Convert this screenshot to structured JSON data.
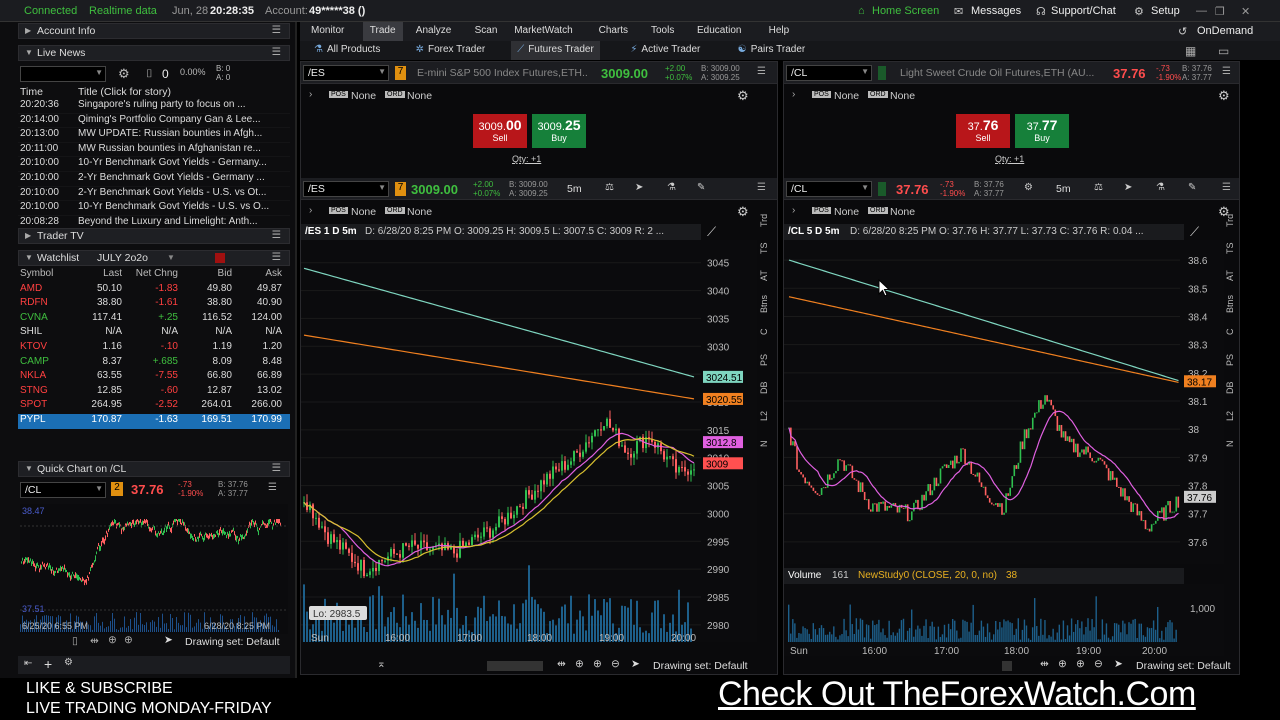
{
  "topbar": {
    "connection": "Connected",
    "feed": "Realtime data",
    "date": "Jun, 28",
    "time": "20:28:35",
    "account_label": "Account:",
    "account": "49*****38 ()",
    "home": "Home Screen",
    "messages": "Messages",
    "support": "Support/Chat",
    "setup": "Setup"
  },
  "nav": {
    "tabs": [
      "Monitor",
      "Trade",
      "Analyze",
      "Scan",
      "MarketWatch",
      "Charts",
      "Tools",
      "Education",
      "Help"
    ],
    "active": "Trade",
    "ondemand": "OnDemand",
    "subtabs": [
      "All Products",
      "Forex Trader",
      "Futures Trader",
      "Active Trader",
      "Pairs Trader"
    ],
    "active_sub": "Futures Trader"
  },
  "left": {
    "account_info": "Account Info",
    "live_news": "Live News",
    "news_toolbar": {
      "zero": "0",
      "pct": "0.00%",
      "b": "B: 0",
      "a": "A: 0"
    },
    "news_headers": {
      "time": "Time",
      "title": "Title (Click for story)"
    },
    "news": [
      {
        "t": "20:20:36",
        "s": "Singapore's ruling party to focus on ..."
      },
      {
        "t": "20:14:00",
        "s": "Qiming's Portfolio Company Gan & Lee..."
      },
      {
        "t": "20:13:00",
        "s": "MW UPDATE: Russian bounties in Afgh..."
      },
      {
        "t": "20:11:00",
        "s": "MW Russian bounties in Afghanistan re..."
      },
      {
        "t": "20:10:00",
        "s": "10-Yr Benchmark Govt Yields - Germany..."
      },
      {
        "t": "20:10:00",
        "s": "2-Yr Benchmark Govt Yields - Germany ..."
      },
      {
        "t": "20:10:00",
        "s": "2-Yr Benchmark Govt Yields - U.S. vs Ot..."
      },
      {
        "t": "20:10:00",
        "s": "10-Yr Benchmark Govt Yields - U.S. vs O..."
      },
      {
        "t": "20:08:28",
        "s": "Beyond the Luxury and Limelight: Anth..."
      }
    ],
    "trader_tv": "Trader TV",
    "watchlist": "Watchlist",
    "watchlist_name": "JULY 2o2o",
    "wl_headers": [
      "Symbol",
      "Last",
      "Net Chng",
      "Bid",
      "Ask"
    ],
    "wl_rows": [
      {
        "sym": "AMD",
        "last": "50.10",
        "chg": "-1.83",
        "bid": "49.80",
        "ask": "49.87",
        "dir": "down"
      },
      {
        "sym": "RDFN",
        "last": "38.80",
        "chg": "-1.61",
        "bid": "38.80",
        "ask": "40.90",
        "dir": "down"
      },
      {
        "sym": "CVNA",
        "last": "117.41",
        "chg": "+.25",
        "bid": "116.52",
        "ask": "124.00",
        "dir": "up"
      },
      {
        "sym": "SHIL",
        "last": "N/A",
        "chg": "N/A",
        "bid": "N/A",
        "ask": "N/A",
        "dir": "none"
      },
      {
        "sym": "KTOV",
        "last": "1.16",
        "chg": "-.10",
        "bid": "1.19",
        "ask": "1.20",
        "dir": "down"
      },
      {
        "sym": "CAMP",
        "last": "8.37",
        "chg": "+.685",
        "bid": "8.09",
        "ask": "8.48",
        "dir": "up"
      },
      {
        "sym": "NKLA",
        "last": "63.55",
        "chg": "-7.55",
        "bid": "66.80",
        "ask": "66.89",
        "dir": "down"
      },
      {
        "sym": "STNG",
        "last": "12.85",
        "chg": "-.60",
        "bid": "12.87",
        "ask": "13.02",
        "dir": "down"
      },
      {
        "sym": "SPOT",
        "last": "264.95",
        "chg": "-2.52",
        "bid": "264.01",
        "ask": "266.00",
        "dir": "down"
      },
      {
        "sym": "PYPL",
        "last": "170.87",
        "chg": "-1.63",
        "bid": "169.51",
        "ask": "170.99",
        "dir": "sel"
      }
    ],
    "quick_chart": "Quick Chart on /CL",
    "qc_symbol": "/CL",
    "qc_price": "37.76",
    "qc_chg": "-.73",
    "qc_pct": "-1.90%",
    "qc_b": "B: 37.76",
    "qc_a": "A: 37.77",
    "qc_label_top": "38.47",
    "qc_label_bottom": "37.51",
    "qc_date1": "6/25/20 6:55 PM",
    "qc_date2": "6/28/20 8:25 PM",
    "drawing_set": "Drawing set: Default"
  },
  "es": {
    "symbol": "/ES",
    "name": "E-mini S&P 500 Index Futures,ETH...",
    "price": "3009.00",
    "chg": "+2.00",
    "pct": "+0.07%",
    "b": "B: 3009.00",
    "a": "A: 3009.25",
    "pos": "None",
    "ord": "None",
    "sell_big": "3009.",
    "sell_small": "00",
    "sell": "Sell",
    "buy_big": "3009.",
    "buy_small": "25",
    "buy": "Buy",
    "qty": "Qty: +1",
    "tf": "5m",
    "chart_title": "/ES 1 D 5m",
    "ohlc": "D: 6/28/20 8:25 PM   O: 3009.25   H: 3009.5   L: 3007.5   C: 3009   R: 2 ...",
    "yticks": [
      "3045",
      "3040",
      "3035",
      "3030",
      "3025",
      "3020",
      "3015",
      "3010",
      "3005",
      "3000",
      "2995",
      "2990",
      "2985",
      "2980"
    ],
    "tags": [
      {
        "v": "3024.51",
        "c": "#7fd6c0"
      },
      {
        "v": "3020.55",
        "c": "#f08020"
      },
      {
        "v": "3012.8",
        "c": "#e060e0"
      },
      {
        "v": "3009",
        "c": "#ff5050"
      }
    ],
    "lo": "Lo: 2983.5",
    "xticks": [
      "Sun",
      "16:00",
      "17:00",
      "18:00",
      "19:00",
      "20:00"
    ],
    "drawing_set": "Drawing set: Default"
  },
  "cl": {
    "symbol": "/CL",
    "name": "Light Sweet Crude Oil Futures,ETH (AU...",
    "price": "37.76",
    "chg": "-.73",
    "pct": "-1.90%",
    "b": "B: 37.76",
    "a": "A: 37.77",
    "pos": "None",
    "ord": "None",
    "sell_big": "37.",
    "sell_small": "76",
    "sell": "Sell",
    "buy_big": "37.",
    "buy_small": "77",
    "buy": "Buy",
    "qty": "Qty: +1",
    "tf": "5m",
    "chart_title": "/CL 5 D 5m",
    "ohlc": "D: 6/28/20 8:25 PM   O: 37.76   H: 37.77   L: 37.73   C: 37.76   R: 0.04 ...",
    "yticks": [
      "38.6",
      "38.5",
      "38.4",
      "38.3",
      "38.2",
      "38.1",
      "38",
      "37.9",
      "37.8",
      "37.7",
      "37.6"
    ],
    "tags": [
      {
        "v": "38.17",
        "c": "#f08020"
      },
      {
        "v": "37.76",
        "c": "#cccccc"
      }
    ],
    "volume": "Volume",
    "vol_val": "161",
    "study": "NewStudy0 (CLOSE, 20, 0, no)",
    "study_val": "38",
    "vol_tick": "1,000",
    "xticks": [
      "Sun",
      "16:00",
      "17:00",
      "18:00",
      "19:00",
      "20:00"
    ],
    "drawing_set": "Drawing set: Default"
  },
  "side_tabs": [
    "Trd",
    "TS",
    "AT",
    "Btns",
    "C",
    "PS",
    "DB",
    "L2",
    "N"
  ],
  "chart_data": [
    {
      "type": "candlestick",
      "title": "/ES 1 D 5m",
      "ylim": [
        2978,
        3048
      ],
      "x": [
        "Sun",
        "16:00",
        "17:00",
        "18:00",
        "19:00",
        "20:00"
      ],
      "last": 3009
    },
    {
      "type": "candlestick",
      "title": "/CL 5 D 5m",
      "ylim": [
        37.55,
        38.65
      ],
      "x": [
        "Sun",
        "16:00",
        "17:00",
        "18:00",
        "19:00",
        "20:00"
      ],
      "last": 37.76
    }
  ],
  "footer": {
    "line1": "LIKE & SUBSCRIBE",
    "line2": "LIVE TRADING MONDAY-FRIDAY",
    "promo": "Check Out TheForexWatch.Com"
  }
}
